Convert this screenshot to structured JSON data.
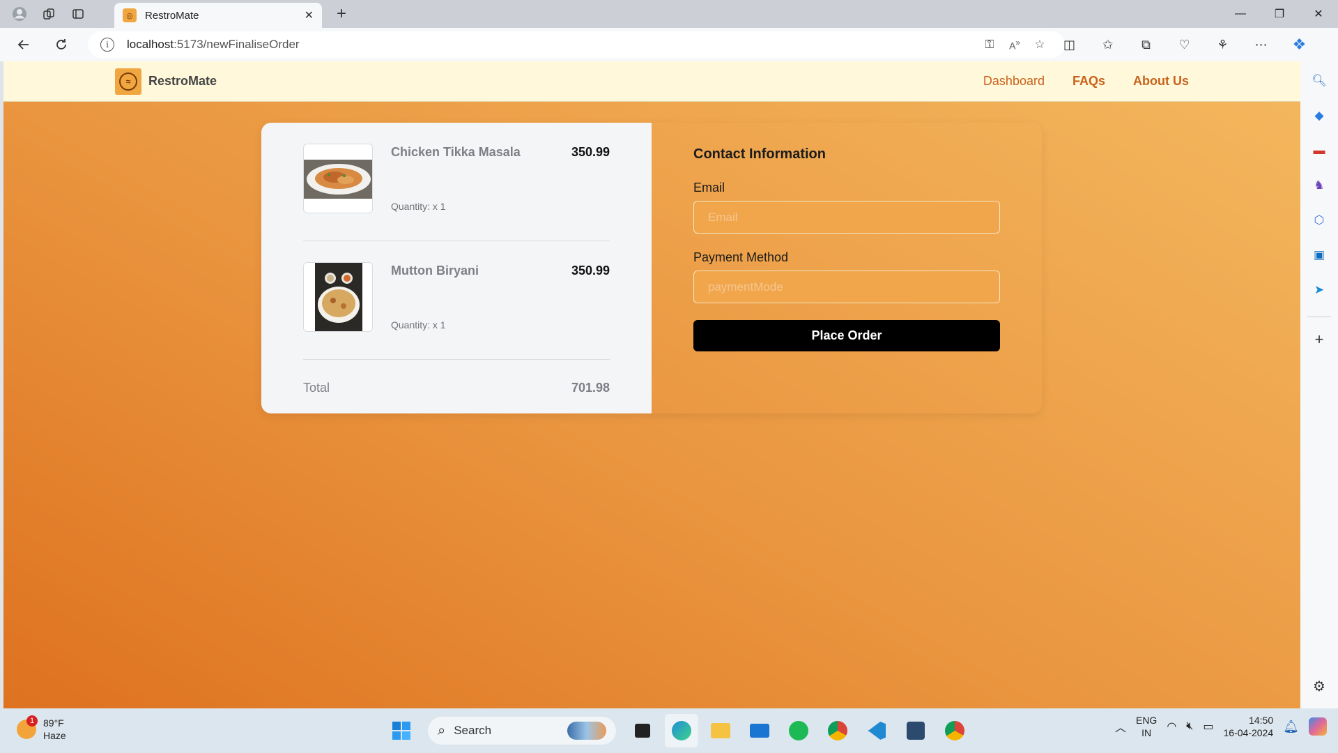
{
  "browser": {
    "tab_title": "RestroMate",
    "tab_close": "✕",
    "new_tab": "+",
    "url_host": "localhost",
    "url_rest": ":5173/newFinaliseOrder",
    "icons": [
      "profile-icon",
      "workspaces-icon",
      "tab-actions-icon",
      "back-icon",
      "refresh-icon",
      "info-icon",
      "password-key-icon",
      "read-aloud-icon",
      "favorite-star-icon",
      "split-screen-icon",
      "favorites-icon",
      "collections-icon",
      "browser-essentials-icon",
      "extensions-icon",
      "more-icon",
      "copilot-icon"
    ]
  },
  "sidebar_icons": [
    "search-icon",
    "shopping-icon",
    "tools-icon",
    "games-icon",
    "microsoft365-icon",
    "outlook-icon",
    "send-icon",
    "add-icon",
    "settings-icon"
  ],
  "app": {
    "brand": "RestroMate",
    "nav": [
      "Dashboard",
      "FAQs",
      "About Us"
    ]
  },
  "cart": {
    "items": [
      {
        "name": "Chicken Tikka Masala",
        "price": "350.99",
        "quantity": "Quantity: x 1"
      },
      {
        "name": "Mutton Biryani",
        "price": "350.99",
        "quantity": "Quantity: x 1"
      }
    ],
    "total_label": "Total",
    "total_value": "701.98"
  },
  "form": {
    "heading": "Contact Information",
    "email_label": "Email",
    "email_placeholder": "Email",
    "payment_label": "Payment Method",
    "payment_placeholder": "paymentMode",
    "submit_label": "Place Order"
  },
  "taskbar": {
    "weather_temp": "89°F",
    "weather_desc": "Haze",
    "weather_badge": "1",
    "search_label": "Search",
    "lang_top": "ENG",
    "lang_bottom": "IN",
    "time": "14:50",
    "date": "16-04-2024"
  },
  "colors": {
    "accent": "#c8621a",
    "gradient_start": "#de7220",
    "gradient_end": "#f4b85e",
    "nav_bg": "#fff8db",
    "button_bg": "#000000"
  }
}
